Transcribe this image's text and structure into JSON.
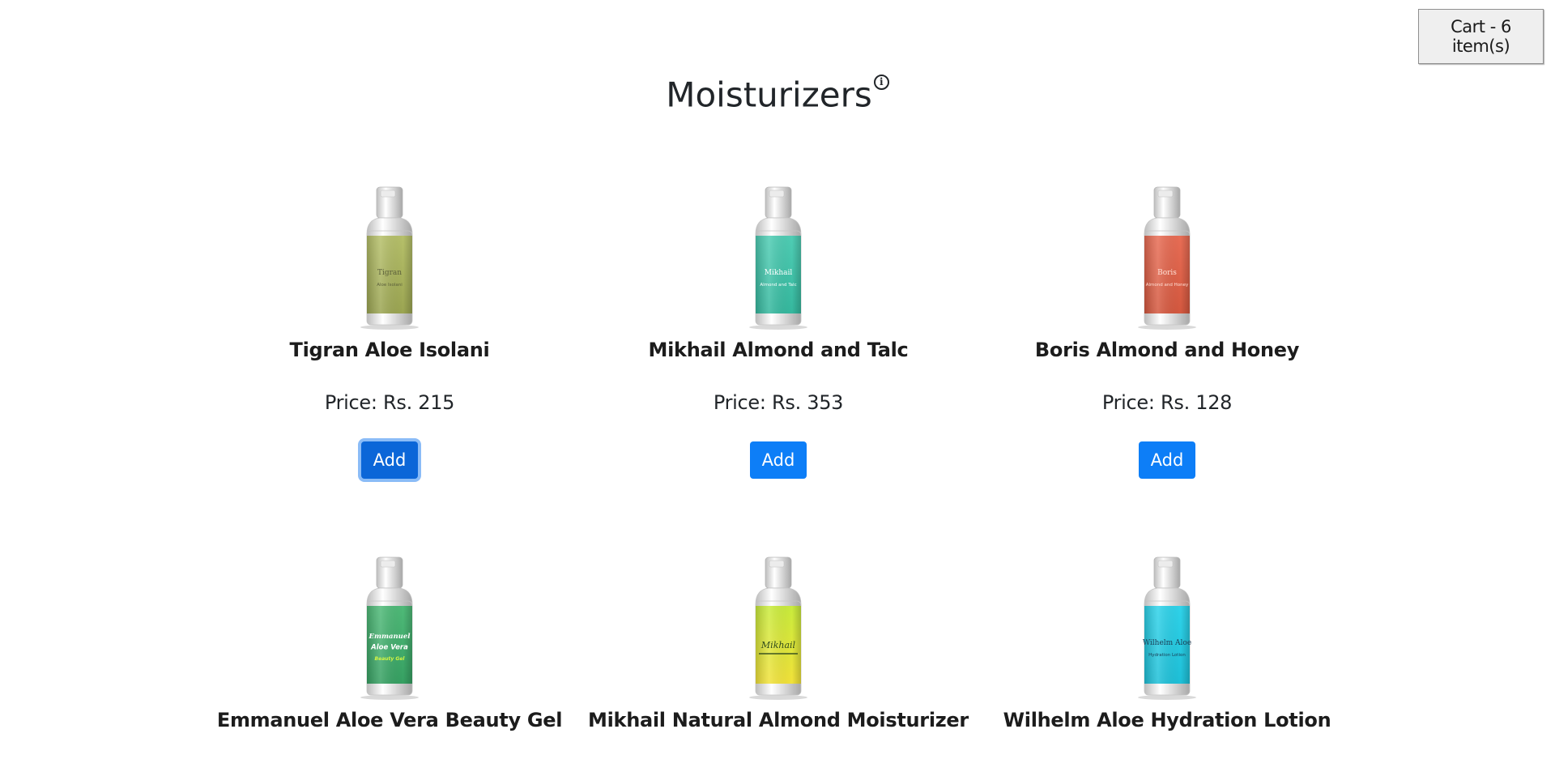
{
  "header": {
    "cart_label": "Cart - 6 item(s)",
    "title": "Moisturizers",
    "info_icon_glyph": "i"
  },
  "products": [
    {
      "name": "Tigran Aloe Isolani",
      "price": "Price: Rs. 215",
      "add_label": "Add",
      "label_color": "#b6c06a",
      "label_color_dark": "#9ba552",
      "brand_line": "Tigran",
      "sub_line": "Aloe Isolani",
      "text_color": "#5b5f3a"
    },
    {
      "name": "Mikhail Almond and Talc",
      "price": "Price: Rs. 353",
      "add_label": "Add",
      "label_color": "#4fcdb4",
      "label_color_dark": "#35b89e",
      "brand_line": "Mikhail",
      "sub_line": "Almond and Talc",
      "text_color": "#ffffff"
    },
    {
      "name": "Boris Almond and Honey",
      "price": "Price: Rs. 128",
      "add_label": "Add",
      "label_color": "#e86d55",
      "label_color_dark": "#d4583f",
      "brand_line": "Boris",
      "sub_line": "Almond and Honey",
      "text_color": "#ffe0d6"
    },
    {
      "name": "Emmanuel Aloe Vera Beauty Gel",
      "price": "",
      "add_label": "",
      "label_color": "#4fba78",
      "label_color_dark": "#36a062",
      "brand_line": "Emmanuel",
      "sub_line": "Aloe Vera",
      "extra_line": "Beauty Gel",
      "text_color": "#ffffff",
      "extra_color": "#d5f542"
    },
    {
      "name": "Mikhail Natural Almond Moisturizer",
      "price": "",
      "add_label": "",
      "label_color": "#c9ec3c",
      "label_color_dark": "#f2e23a",
      "brand_line": "Mikhail",
      "sub_line": "",
      "text_color": "#2f4a1c"
    },
    {
      "name": "Wilhelm Aloe Hydration Lotion",
      "price": "",
      "add_label": "",
      "label_color": "#2fd3ea",
      "label_color_dark": "#1ec0d8",
      "brand_line": "Wilhelm Aloe",
      "sub_line": "Hydration Lotion",
      "text_color": "#1b3d55"
    }
  ]
}
